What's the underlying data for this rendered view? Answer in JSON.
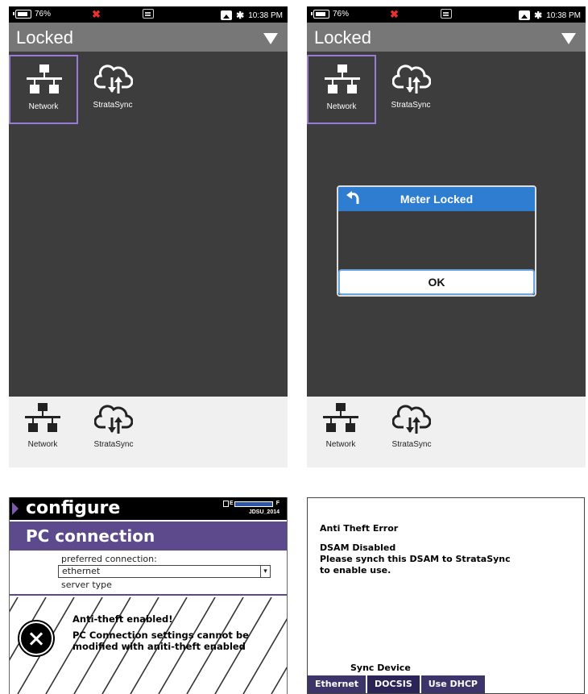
{
  "status_bar": {
    "battery": "76%",
    "time": "10:38 PM"
  },
  "launcher": {
    "title": "Locked",
    "apps": [
      {
        "label": "Network"
      },
      {
        "label": "StrataSync"
      }
    ],
    "dock": [
      {
        "label": "Network"
      },
      {
        "label": "StrataSync"
      }
    ]
  },
  "dialog": {
    "title": "Meter Locked",
    "ok_label": "OK"
  },
  "configure": {
    "header": "configure",
    "meter": {
      "empty": "E",
      "full": "F",
      "device": "JDSU_2014"
    },
    "section_title": "PC connection",
    "preferred_label": "preferred connection:",
    "preferred_value": "ethernet",
    "server_type_label": "server type",
    "anti_title": "Anti-theft enabled!",
    "anti_message": "PC Connection settings cannot be modified with aniti-theft enabled"
  },
  "anti_theft_error": {
    "title": "Anti Theft Error",
    "line1": "DSAM Disabled",
    "line2": "Please synch this DSAM to StrataSync",
    "line3": "to enable use.",
    "sync_label": "Sync Device",
    "tabs": [
      "Ethernet",
      "DOCSIS",
      "Use DHCP"
    ]
  }
}
